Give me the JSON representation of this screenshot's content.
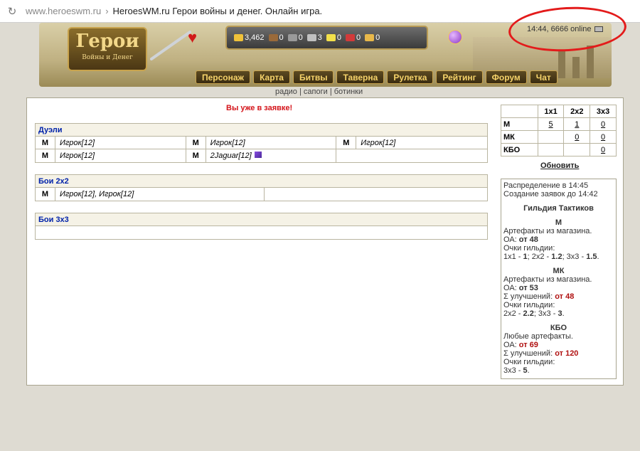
{
  "browser": {
    "domain": "www.heroeswm.ru",
    "page_title": "HeroesWM.ru Герои войны и денег. Онлайн игра."
  },
  "header": {
    "logo_main": "Герои",
    "logo_sub": "Войны и Денег",
    "resources": [
      "3,462",
      "0",
      "0",
      "3",
      "0",
      "0",
      "0"
    ],
    "status_text": "14:44, 6666 online",
    "nav": [
      "Персонаж",
      "Карта",
      "Битвы",
      "Таверна",
      "Рулетка",
      "Рейтинг",
      "Форум",
      "Чат"
    ]
  },
  "sublinks": [
    "радио",
    "сапоги",
    "ботинки"
  ],
  "main": {
    "notice": "Вы уже в заявке!",
    "duels_title": "Дуэли",
    "duels_rows": [
      [
        {
          "m": "М",
          "p": "Игрок[12]"
        },
        {
          "m": "М",
          "p": "Игрок[12]"
        },
        {
          "m": "М",
          "p": "Игрок[12]"
        }
      ],
      [
        {
          "m": "М",
          "p": "Игрок[12]"
        },
        {
          "m": "М",
          "p": "2Jaguar[12]"
        }
      ]
    ],
    "team2_title": "Бои 2x2",
    "team2_row": {
      "m": "М",
      "p": "Игрок[12], Игрок[12]"
    },
    "team3_title": "Бои 3x3"
  },
  "stats": {
    "headers": [
      "1x1",
      "2x2",
      "3x3"
    ],
    "rows": [
      {
        "label": "М",
        "v": [
          "5",
          "1",
          "0"
        ]
      },
      {
        "label": "МК",
        "v": [
          "",
          "0",
          "0"
        ]
      },
      {
        "label": "КБО",
        "v": [
          "",
          "",
          "0"
        ]
      }
    ],
    "refresh": "Обновить"
  },
  "info": {
    "l1": "Распределение в 14:45",
    "l2": "Создание заявок до 14:42",
    "guild": "Гильдия Тактиков",
    "m_title": "М",
    "m_l1": "Артефакты из магазина.",
    "m_oa_label": "ОА: ",
    "m_oa": "от 48",
    "m_pts_label": "Очки гильдии:",
    "m_pts_a": "1x1 - ",
    "m_pts_a_v": "1",
    "m_pts_b": "; 2x2 - ",
    "m_pts_b_v": "1.2",
    "m_pts_c": "; 3x3 - ",
    "m_pts_c_v": "1.5",
    "mk_title": "МК",
    "mk_l1": "Артефакты из магазина.",
    "mk_oa_label": "ОА: ",
    "mk_oa": "от 53",
    "mk_up_label": "Σ улучшений: ",
    "mk_up": "от 48",
    "mk_pts_label": "Очки гильдии:",
    "mk_pts_a": "2x2 - ",
    "mk_pts_a_v": "2.2",
    "mk_pts_b": "; 3x3 - ",
    "mk_pts_b_v": "3",
    "kbo_title": "КБО",
    "kbo_l1": "Любые артефакты.",
    "kbo_oa_label": "ОА: ",
    "kbo_oa": "от 69",
    "kbo_up_label": "Σ улучшений: ",
    "kbo_up": "от 120",
    "kbo_pts_label": "Очки гильдии:",
    "kbo_pts_a": "3x3 - ",
    "kbo_pts_a_v": "5"
  }
}
